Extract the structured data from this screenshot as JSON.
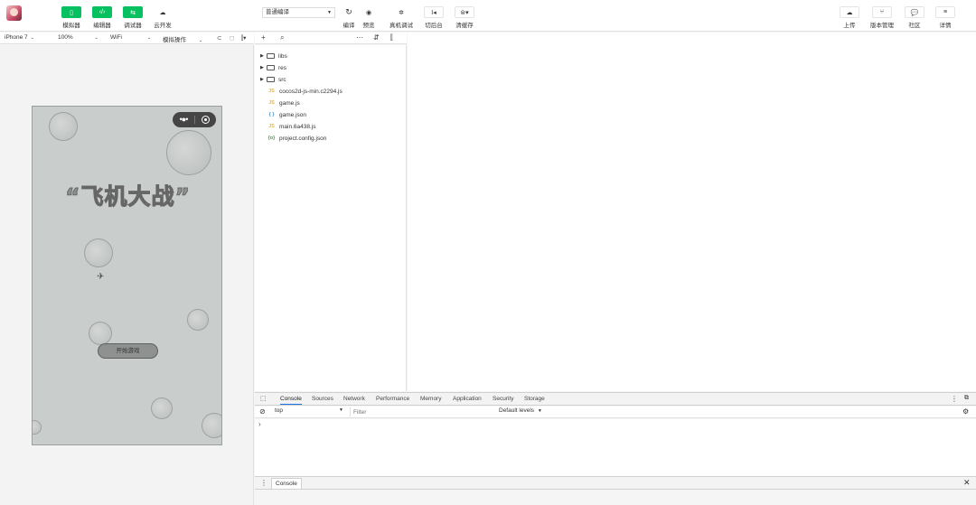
{
  "toolbar": {
    "left_buttons": [
      {
        "label": "模拟器",
        "icon": "phone-icon"
      },
      {
        "label": "编辑器",
        "icon": "code-icon"
      },
      {
        "label": "调试器",
        "icon": "debug-icon"
      },
      {
        "label": "云开发",
        "icon": "cloud-dev-icon"
      }
    ],
    "compile_mode": "普通编译",
    "center_buttons": [
      {
        "label": "编译",
        "icon": "refresh-icon"
      },
      {
        "label": "预览",
        "icon": "eye-icon"
      },
      {
        "label": "真机调试",
        "icon": "bug-icon"
      },
      {
        "label": "切后台",
        "icon": "background-icon"
      },
      {
        "label": "清缓存",
        "icon": "clear-cache-icon"
      }
    ],
    "right_buttons": [
      {
        "label": "上传",
        "icon": "upload-icon"
      },
      {
        "label": "版本管理",
        "icon": "version-icon"
      },
      {
        "label": "社区",
        "icon": "community-icon"
      },
      {
        "label": "详情",
        "icon": "menu-icon"
      }
    ]
  },
  "simulator_bar": {
    "device": "iPhone 7",
    "zoom": "100%",
    "network": "WiFi",
    "operation": "模拟操作"
  },
  "game": {
    "title": "“飞机大战”",
    "start_button": "开始游戏"
  },
  "file_tree": {
    "folders": [
      "libs",
      "res",
      "src"
    ],
    "files": [
      {
        "name": "cocos2d-js-min.c2294.js",
        "type": "js"
      },
      {
        "name": "game.js",
        "type": "js"
      },
      {
        "name": "game.json",
        "type": "json"
      },
      {
        "name": "main.6a438.js",
        "type": "js"
      },
      {
        "name": "project.config.json",
        "type": "cfg"
      }
    ]
  },
  "devtools": {
    "tabs": [
      "Console",
      "Sources",
      "Network",
      "Performance",
      "Memory",
      "Application",
      "Security",
      "Storage"
    ],
    "active_tab": "Console",
    "context": "top",
    "filter_placeholder": "Filter",
    "levels": "Default levels",
    "prompt": "›",
    "drawer_tab": "Console"
  }
}
